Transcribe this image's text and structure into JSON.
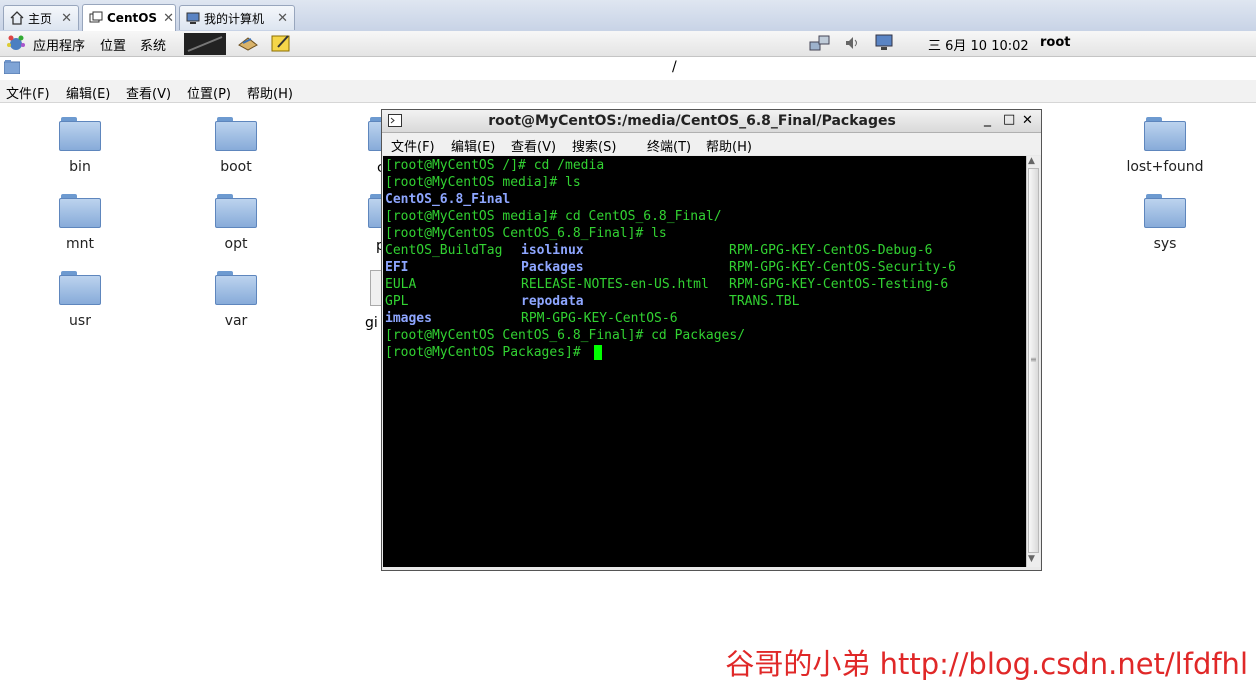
{
  "vm_tabs": [
    {
      "label": "主页",
      "icon": "home-icon"
    },
    {
      "label": "CentOS",
      "icon": "vm-icon",
      "active": true
    },
    {
      "label": "我的计算机",
      "icon": "computer-icon"
    }
  ],
  "panel": {
    "menus": [
      "应用程序",
      "位置",
      "系统"
    ],
    "launchers": [
      "terminal-launcher-icon",
      "mail-launcher-icon",
      "notes-launcher-icon"
    ],
    "tray_icons": [
      "network-icon",
      "volume-icon",
      "network-connection-icon"
    ],
    "clock": "三 6月 10 10:02",
    "user": "root"
  },
  "nautilus": {
    "path": "/",
    "menus": [
      "文件(F)",
      "编辑(E)",
      "查看(V)",
      "位置(P)",
      "帮助(H)"
    ],
    "folders": [
      {
        "label": "bin"
      },
      {
        "label": "boot"
      },
      {
        "label": "lost+found"
      },
      {
        "label": "mnt"
      },
      {
        "label": "opt"
      },
      {
        "label": "sys"
      },
      {
        "label": "usr"
      },
      {
        "label": "var"
      }
    ],
    "partial_labels": [
      "c",
      "p",
      "gi"
    ]
  },
  "terminal": {
    "title": "root@MyCentOS:/media/CentOS_6.8_Final/Packages",
    "window_buttons": {
      "minimize": "_",
      "maximize": "□",
      "close": "✕"
    },
    "menus": [
      "文件(F)",
      "编辑(E)",
      "查看(V)",
      "搜索(S)",
      "终端(T)",
      "帮助(H)"
    ],
    "lines": [
      "[root@MyCentOS /]# cd /media",
      "[root@MyCentOS media]# ls",
      "[root@MyCentOS media]# cd CentOS_6.8_Final/",
      "[root@MyCentOS CentOS_6.8_Final]# ls",
      "[root@MyCentOS CentOS_6.8_Final]# cd Packages/",
      "[root@MyCentOS Packages]# "
    ],
    "media_listing": "CentOS_6.8_Final",
    "ls_columns": [
      [
        "CentOS_BuildTag",
        "EFI",
        "EULA",
        "GPL",
        "images"
      ],
      [
        "isolinux",
        "Packages",
        "RELEASE-NOTES-en-US.html",
        "repodata",
        "RPM-GPG-KEY-CentOS-6"
      ],
      [
        "RPM-GPG-KEY-CentOS-Debug-6",
        "RPM-GPG-KEY-CentOS-Security-6",
        "RPM-GPG-KEY-CentOS-Testing-6",
        "TRANS.TBL"
      ]
    ]
  },
  "watermark": "谷哥的小弟 http://blog.csdn.net/lfdfhl",
  "colors": {
    "terminal_bg": "#000000",
    "terminal_text": "#32d232",
    "terminal_dir": "#8ea6ff",
    "cursor": "#00ff00",
    "watermark": "#e02828"
  }
}
